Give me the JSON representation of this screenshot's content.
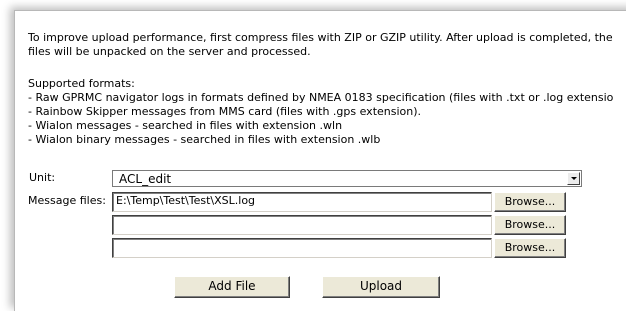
{
  "intro": {
    "line1": "To improve upload performance, first compress files with ZIP or GZIP utility. After upload is completed, the",
    "line2": "files will be unpacked on the server and processed."
  },
  "formats": {
    "header": "Supported formats:",
    "items": [
      "- Raw GPRMC navigator logs in formats defined by NMEA 0183 specification (files with .txt or .log extensio",
      "- Rainbow Skipper messages from MMS card (files with .gps extension).",
      "- Wialon messages - searched in files with extension .wln",
      "- Wialon binary messages - searched in files with extension .wlb"
    ]
  },
  "form": {
    "unit_label": "Unit:",
    "unit_value": "ACL_edit",
    "message_files_label": "Message files:",
    "files": [
      {
        "value": "E:\\Temp\\Test\\Test\\XSL.log",
        "browse_label": "Browse..."
      },
      {
        "value": "",
        "browse_label": "Browse..."
      },
      {
        "value": "",
        "browse_label": "Browse..."
      }
    ]
  },
  "actions": {
    "add_file_label": "Add File",
    "upload_label": "Upload"
  }
}
